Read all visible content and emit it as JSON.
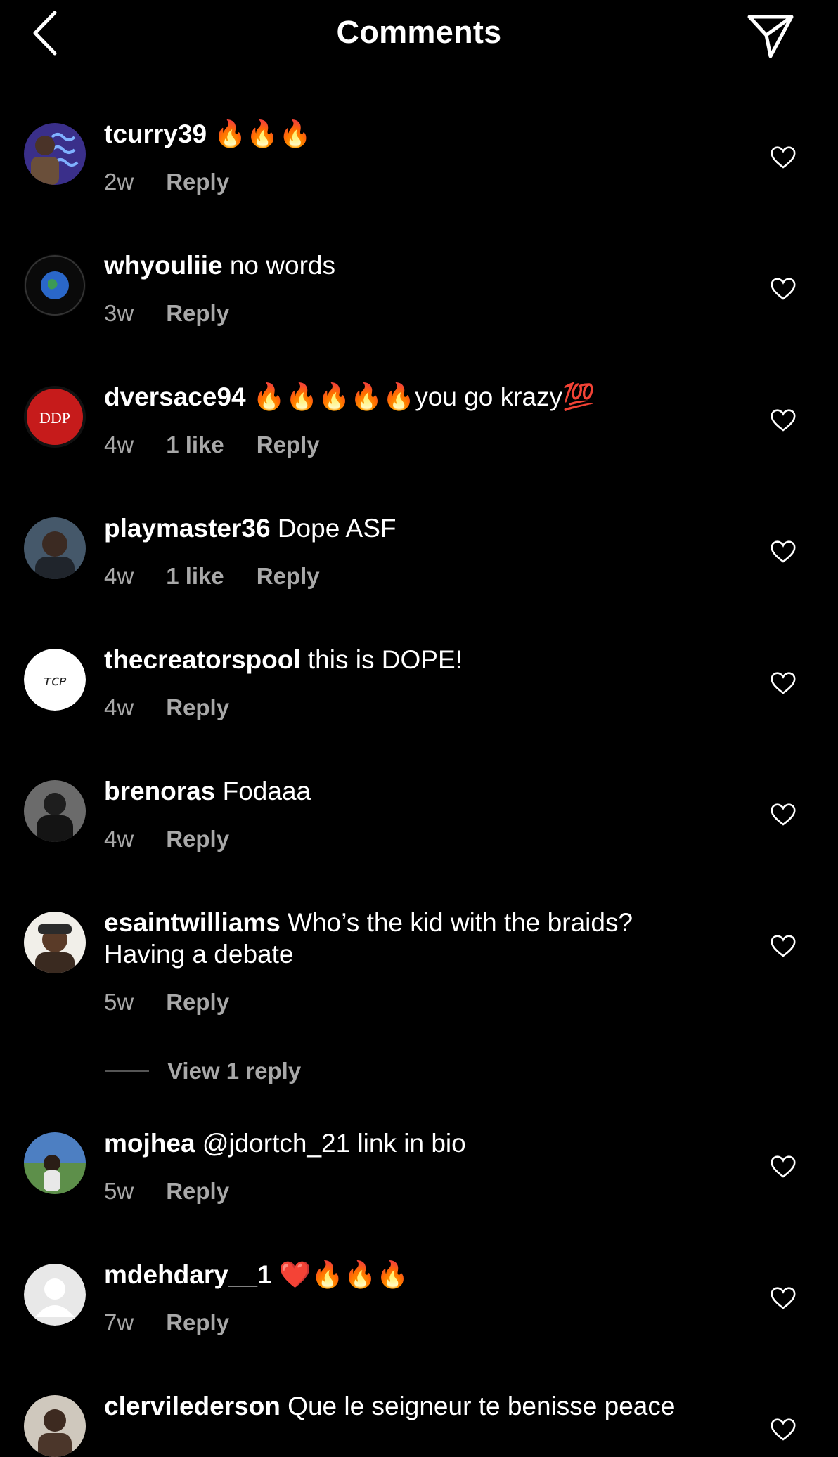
{
  "header": {
    "title": "Comments"
  },
  "comments": [
    {
      "username": "tcurry39",
      "text": " 🔥🔥🔥",
      "age": "2w",
      "likes": "",
      "reply": "Reply"
    },
    {
      "username": "whyouliie",
      "text": " no words",
      "age": "3w",
      "likes": "",
      "reply": "Reply"
    },
    {
      "username": "dversace94",
      "text": " 🔥🔥🔥🔥🔥you go krazy💯",
      "age": "4w",
      "likes": "1 like",
      "reply": "Reply"
    },
    {
      "username": "playmaster36",
      "text": " Dope ASF",
      "age": "4w",
      "likes": "1 like",
      "reply": "Reply"
    },
    {
      "username": "thecreatorspool",
      "text": " this is DOPE!",
      "age": "4w",
      "likes": "",
      "reply": "Reply"
    },
    {
      "username": "brenoras",
      "text": " Fodaaa",
      "age": "4w",
      "likes": "",
      "reply": "Reply"
    },
    {
      "username": "esaintwilliams",
      "text": " Who’s the kid with the braids? Having a debate",
      "age": "5w",
      "likes": "",
      "reply": "Reply"
    },
    {
      "username": "mojhea",
      "text": " @jdortch_21 link in bio",
      "age": "5w",
      "likes": "",
      "reply": "Reply"
    },
    {
      "username": "mdehdary__1",
      "text": " ❤️🔥🔥🔥",
      "age": "7w",
      "likes": "",
      "reply": "Reply"
    },
    {
      "username": "clervilederson",
      "text": " Que le seigneur te benisse peace",
      "age": "",
      "likes": "",
      "reply": ""
    }
  ],
  "view_replies": "View 1 reply",
  "avatar_badges": {
    "dversace94": "DDP",
    "thecreatorspool": "ᴛᴄᴘ"
  },
  "colors": {
    "background": "#000000",
    "text": "#ffffff",
    "muted": "#a8a8a8",
    "fire": "#ff7a00",
    "heart": "#e0245e"
  },
  "icons": {
    "back": "chevron-left-icon",
    "share": "paper-plane-icon",
    "like": "heart-outline-icon"
  }
}
